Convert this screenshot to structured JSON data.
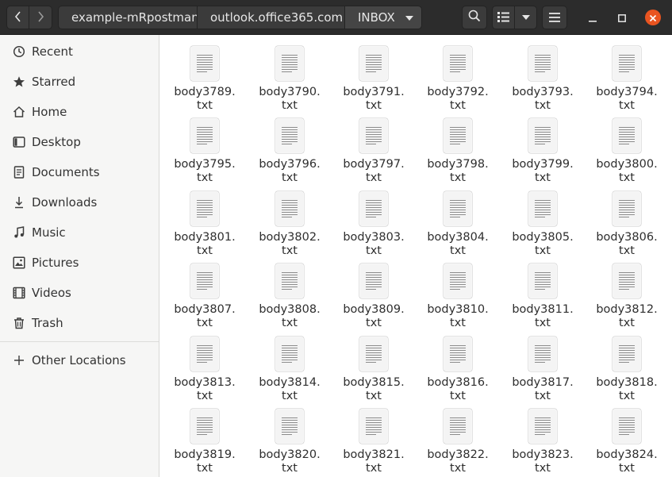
{
  "header": {
    "breadcrumbs": [
      {
        "label": "example-mRpostman"
      },
      {
        "label": "outlook.office365.com"
      },
      {
        "label": "INBOX"
      }
    ],
    "icons": {
      "back": "chevron-left-icon",
      "forward": "chevron-right-icon",
      "search": "search-icon",
      "list_view": "list-view-icon",
      "view_options": "chevron-down-icon",
      "menu": "hamburger-menu-icon",
      "minimize": "minimize-icon",
      "maximize": "maximize-icon",
      "close": "close-icon"
    },
    "colors": {
      "headerbar": "#2c2c2c",
      "close_button": "#e95420"
    }
  },
  "sidebar": {
    "items": [
      {
        "label": "Recent",
        "icon": "clock-icon"
      },
      {
        "label": "Starred",
        "icon": "star-icon"
      },
      {
        "label": "Home",
        "icon": "home-icon"
      },
      {
        "label": "Desktop",
        "icon": "desktop-icon"
      },
      {
        "label": "Documents",
        "icon": "documents-icon"
      },
      {
        "label": "Downloads",
        "icon": "download-icon"
      },
      {
        "label": "Music",
        "icon": "music-icon"
      },
      {
        "label": "Pictures",
        "icon": "pictures-icon"
      },
      {
        "label": "Videos",
        "icon": "videos-icon"
      },
      {
        "label": "Trash",
        "icon": "trash-icon"
      }
    ],
    "other_locations": {
      "label": "Other Locations",
      "icon": "plus-icon"
    }
  },
  "files": {
    "rows": [
      [
        {
          "line1": "body3789.",
          "line2": "txt"
        },
        {
          "line1": "body3790.",
          "line2": "txt"
        },
        {
          "line1": "body3791.",
          "line2": "txt"
        },
        {
          "line1": "body3792.",
          "line2": "txt"
        },
        {
          "line1": "body3793.",
          "line2": "txt"
        },
        {
          "line1": "body3794.",
          "line2": "txt"
        }
      ],
      [
        {
          "line1": "body3795.",
          "line2": "txt"
        },
        {
          "line1": "body3796.",
          "line2": "txt"
        },
        {
          "line1": "body3797.",
          "line2": "txt"
        },
        {
          "line1": "body3798.",
          "line2": "txt"
        },
        {
          "line1": "body3799.",
          "line2": "txt"
        },
        {
          "line1": "body3800.",
          "line2": "txt"
        }
      ],
      [
        {
          "line1": "body3801.",
          "line2": "txt"
        },
        {
          "line1": "body3802.",
          "line2": "txt"
        },
        {
          "line1": "body3803.",
          "line2": "txt"
        },
        {
          "line1": "body3804.",
          "line2": "txt"
        },
        {
          "line1": "body3805.",
          "line2": "txt"
        },
        {
          "line1": "body3806.",
          "line2": "txt"
        }
      ],
      [
        {
          "line1": "body3807.",
          "line2": "txt"
        },
        {
          "line1": "body3808.",
          "line2": "txt"
        },
        {
          "line1": "body3809.",
          "line2": "txt"
        },
        {
          "line1": "body3810.",
          "line2": "txt"
        },
        {
          "line1": "body3811.",
          "line2": "txt"
        },
        {
          "line1": "body3812.",
          "line2": "txt"
        }
      ],
      [
        {
          "line1": "body3813.",
          "line2": "txt"
        },
        {
          "line1": "body3814.",
          "line2": "txt"
        },
        {
          "line1": "body3815.",
          "line2": "txt"
        },
        {
          "line1": "body3816.",
          "line2": "txt"
        },
        {
          "line1": "body3817.",
          "line2": "txt"
        },
        {
          "line1": "body3818.",
          "line2": "txt"
        }
      ],
      [
        {
          "line1": "body3819.",
          "line2": "txt"
        },
        {
          "line1": "body3820.",
          "line2": "txt"
        },
        {
          "line1": "body3821.",
          "line2": "txt"
        },
        {
          "line1": "body3822.",
          "line2": "txt"
        },
        {
          "line1": "body3823.",
          "line2": "txt"
        },
        {
          "line1": "body3824.",
          "line2": "txt"
        }
      ]
    ],
    "file_icon": "text-document-icon"
  }
}
